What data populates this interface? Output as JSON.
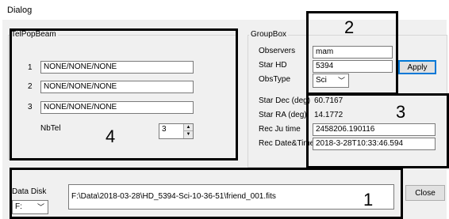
{
  "dialog": {
    "title": "Dialog"
  },
  "telpopbeam": {
    "caption": "TelPopBeam",
    "rows": [
      {
        "label": "1",
        "value": "NONE/NONE/NONE"
      },
      {
        "label": "2",
        "value": "NONE/NONE/NONE"
      },
      {
        "label": "3",
        "value": "NONE/NONE/NONE"
      }
    ],
    "nbtel_label": "NbTel",
    "nbtel_value": "3"
  },
  "groupbox": {
    "caption": "GroupBox",
    "observers_label": "Observers",
    "observers_value": "mam",
    "star_hd_label": "Star HD",
    "star_hd_value": "5394",
    "obstype_label": "ObsType",
    "obstype_value": "Sci",
    "apply_label": "Apply",
    "star_dec_label": "Star Dec (deg)",
    "star_dec_value": "60.7167",
    "star_ra_label": "Star RA (deg)",
    "star_ra_value": "14.1772",
    "rec_ju_label": "Rec Ju time",
    "rec_ju_value": "2458206.190116",
    "rec_date_label": "Rec Date&Time",
    "rec_date_value": "2018-3-28T10:33:46.594"
  },
  "footer": {
    "data_disk_label": "Data Disk",
    "drive_value": "F:",
    "path_value": "F:\\Data\\2018-03-28\\HD_5394-Sci-10-36-51\\friend_001.fits",
    "close_label": "Close"
  },
  "annotations": [
    "1",
    "2",
    "3",
    "4"
  ]
}
